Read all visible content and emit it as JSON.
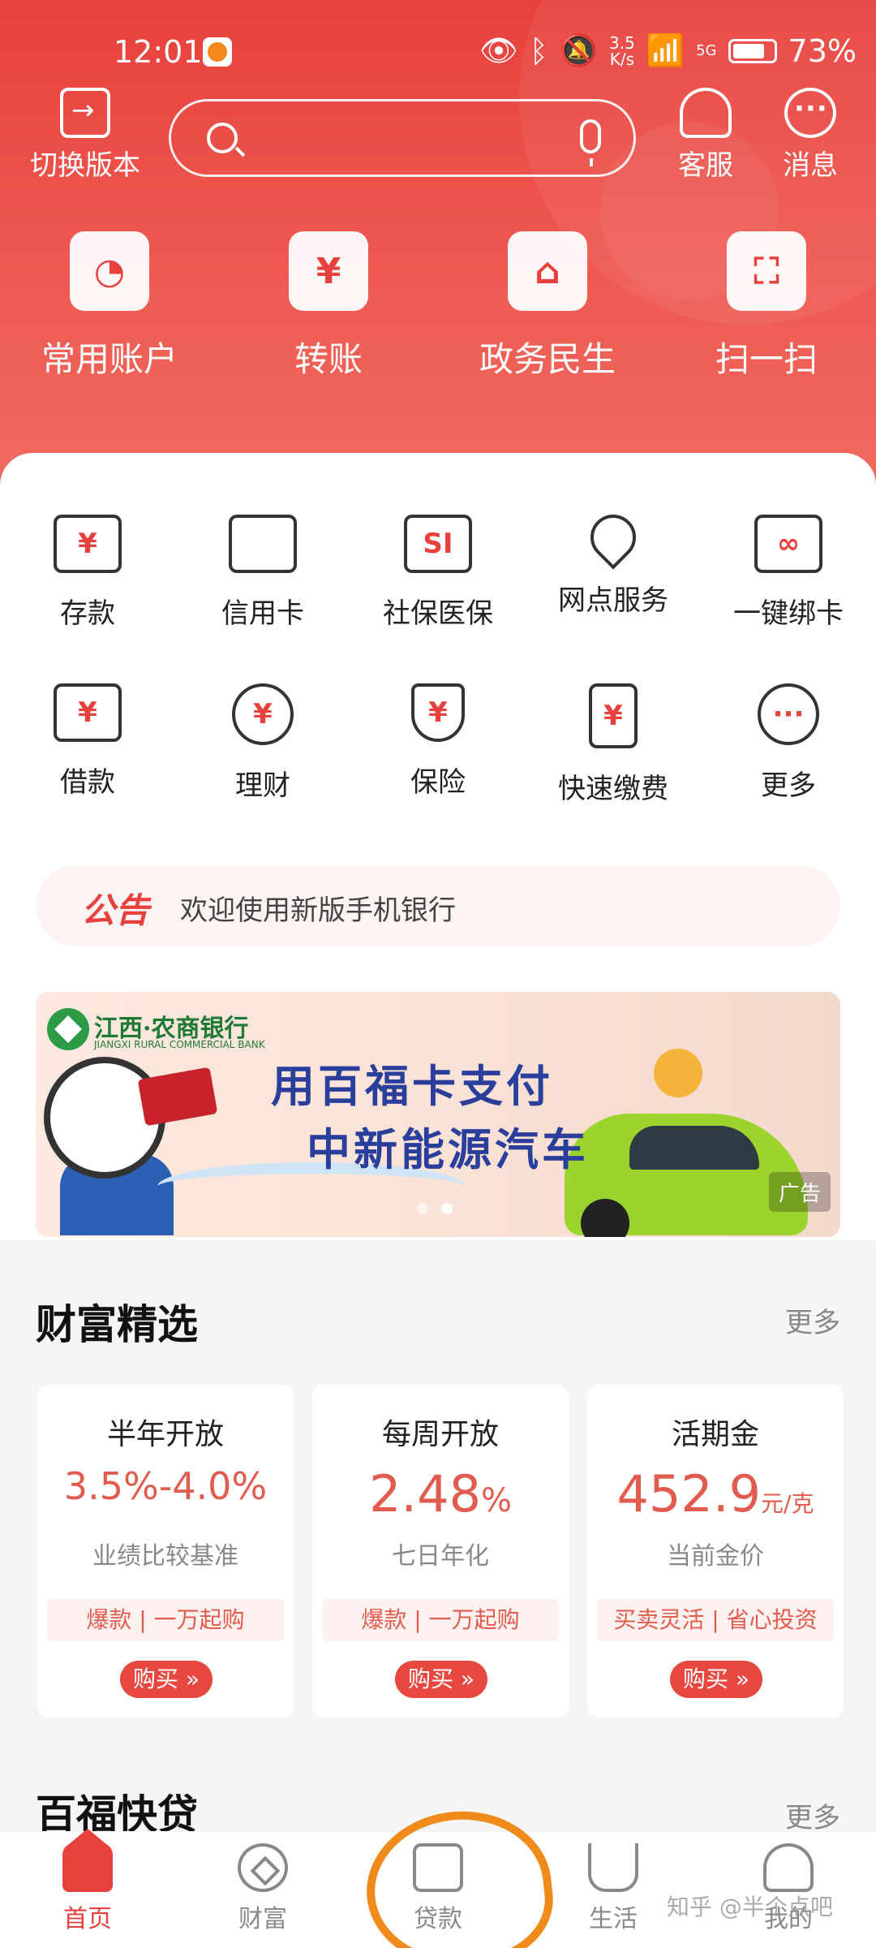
{
  "status_bar": {
    "time": "12:01",
    "net_speed_value": "3.5",
    "net_speed_unit": "K/s",
    "signal": "5G",
    "battery": "73%"
  },
  "header": {
    "switch_version_label": "切换版本",
    "customer_service_label": "客服",
    "messages_label": "消息"
  },
  "quick_actions": [
    {
      "label": "常用账户",
      "icon": "pie-chart-icon"
    },
    {
      "label": "转账",
      "icon": "yuan-transfer-icon"
    },
    {
      "label": "政务民生",
      "icon": "house-heart-icon"
    },
    {
      "label": "扫一扫",
      "icon": "scan-icon"
    }
  ],
  "services": [
    {
      "label": "存款",
      "icon": "deposit-card-icon"
    },
    {
      "label": "信用卡",
      "icon": "credit-card-icon"
    },
    {
      "label": "社保医保",
      "icon": "social-security-icon"
    },
    {
      "label": "网点服务",
      "icon": "location-pin-icon"
    },
    {
      "label": "一键绑卡",
      "icon": "link-card-icon"
    },
    {
      "label": "借款",
      "icon": "loan-hand-icon"
    },
    {
      "label": "理财",
      "icon": "wealth-circle-icon"
    },
    {
      "label": "保险",
      "icon": "shield-icon"
    },
    {
      "label": "快速缴费",
      "icon": "quick-pay-icon"
    },
    {
      "label": "更多",
      "icon": "more-dots-icon"
    }
  ],
  "notice": {
    "tag": "公告",
    "text": "欢迎使用新版手机银行"
  },
  "banner": {
    "bank_name": "江西·农商银行",
    "bank_name_en": "JIANGXI RURAL COMMERCIAL BANK",
    "line1": "用百福卡支付",
    "line2": "中新能源汽车",
    "ad_label": "广告",
    "active_slide": 2,
    "slides": 2
  },
  "wealth_section": {
    "title": "财富精选",
    "more": "更多",
    "products": [
      {
        "name": "半年开放",
        "value": "3.5%-4.0%",
        "unit": "",
        "desc": "业绩比较基准",
        "tag1": "爆款",
        "tag2": "一万起购",
        "button": "购买 »"
      },
      {
        "name": "每周开放",
        "value": "2.48",
        "unit": "%",
        "desc": "七日年化",
        "tag1": "爆款",
        "tag2": "一万起购",
        "button": "购买 »"
      },
      {
        "name": "活期金",
        "value": "452.9",
        "unit": "元/克",
        "desc": "当前金价",
        "tag1": "买卖灵活",
        "tag2": "省心投资",
        "button": "购买 »"
      }
    ]
  },
  "loan_section": {
    "title": "百福快贷",
    "more": "更多"
  },
  "tabbar": [
    {
      "label": "首页",
      "active": true
    },
    {
      "label": "财富",
      "active": false
    },
    {
      "label": "贷款",
      "active": false
    },
    {
      "label": "生活",
      "active": false
    },
    {
      "label": "我的",
      "active": false
    }
  ],
  "watermark": "知乎 @半个点吧",
  "colors": {
    "brand_red": "#e8413d",
    "value_red": "#e25b4f",
    "annotation_orange": "#f08a1a"
  }
}
